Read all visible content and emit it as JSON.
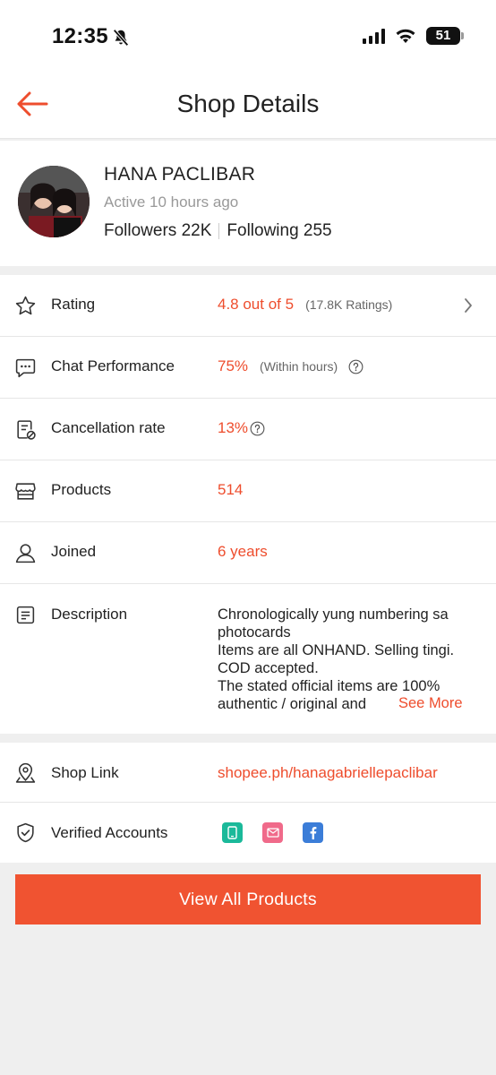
{
  "status_bar": {
    "time": "12:35",
    "battery": "51"
  },
  "header": {
    "title": "Shop Details"
  },
  "profile": {
    "name": "HANA PACLIBAR",
    "active": "Active 10 hours ago",
    "followers": "Followers 22K",
    "following": "Following 255"
  },
  "stats": [
    {
      "label": "Rating",
      "value": "4.8 out of 5",
      "sub": "(17.8K Ratings)"
    },
    {
      "label": "Chat Performance",
      "value": "75%",
      "sub": "(Within hours)"
    },
    {
      "label": "Cancellation rate",
      "value": "13%"
    },
    {
      "label": "Products",
      "value": "514"
    },
    {
      "label": "Joined",
      "value": "6 years"
    }
  ],
  "description": {
    "label": "Description",
    "lines": [
      "Chronologically yung numbering sa",
      "photocards",
      "Items are all ONHAND. Selling tingi.",
      "COD accepted.",
      "The stated official items are 100%",
      "authentic / original and"
    ],
    "see_more": "See More"
  },
  "shop_link": {
    "label": "Shop Link",
    "value": "shopee.ph/hanagabriellepaclibar"
  },
  "verified": {
    "label": "Verified Accounts",
    "badges": [
      {
        "name": "phone",
        "color": "#1bb99a"
      },
      {
        "name": "email",
        "color": "#f06a8a"
      },
      {
        "name": "facebook",
        "color": "#3b7dd8"
      }
    ]
  },
  "cta": {
    "label": "View All Products"
  },
  "colors": {
    "accent": "#ee4d2d",
    "button": "#f05331"
  }
}
